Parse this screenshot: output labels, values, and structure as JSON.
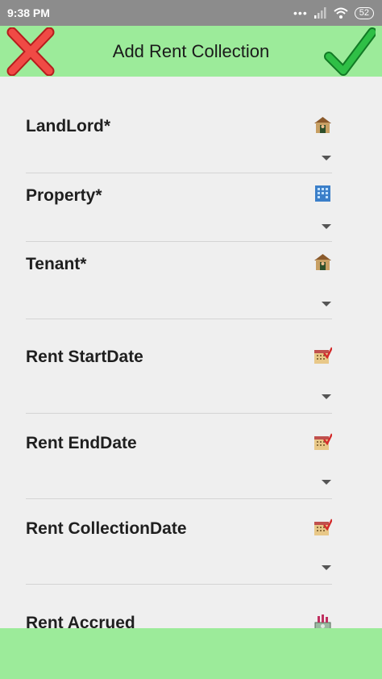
{
  "status_bar": {
    "time": "9:38 PM",
    "battery": "52"
  },
  "header": {
    "title": "Add Rent Collection"
  },
  "fields": [
    {
      "label": "LandLord*",
      "icon": "house-icon"
    },
    {
      "label": "Property*",
      "icon": "building-icon"
    },
    {
      "label": "Tenant*",
      "icon": "house-icon"
    },
    {
      "label": "Rent StartDate",
      "icon": "calendar-icon"
    },
    {
      "label": "Rent EndDate",
      "icon": "calendar-icon"
    },
    {
      "label": "Rent CollectionDate",
      "icon": "calendar-icon"
    },
    {
      "label": "Rent Accrued",
      "icon": "money-icon"
    }
  ],
  "colors": {
    "accent": "#9ceb9a",
    "background": "#efefef",
    "status_bar": "#8c8c8c"
  }
}
